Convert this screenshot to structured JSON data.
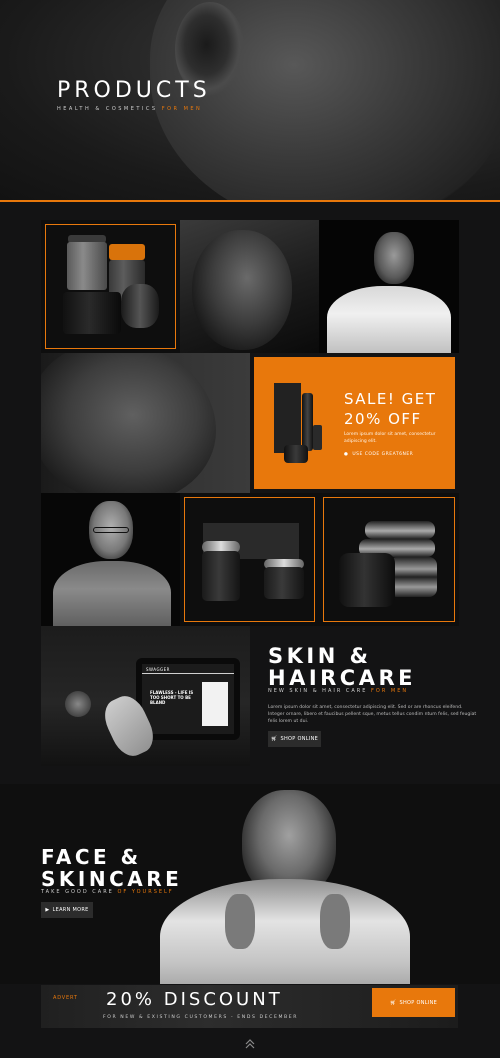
{
  "hero": {
    "title": "PRODUCTS",
    "subtitle": "HEALTH & COSMETICS",
    "subtitle_accent": "FOR MEN"
  },
  "sale": {
    "title": "SALE! GET 20% OFF",
    "description": "Lorem ipsum dolor sit amet, consectetur adipiscing elit.",
    "code": "USE CODE GREAT6NER"
  },
  "skin": {
    "title_line1": "SKIN &",
    "title_line2": "HAIRCARE",
    "subtitle": "NEW SKIN & HAIR CARE",
    "subtitle_accent": "FOR MEN",
    "description": "Lorem ipsum dolor sit amet, consectetur adipiscing elit. Sed or are rhoncus eleifend. Integer ornare, libero et faucibus pellent sque, metus tellus condim ntum felis, sed feugiat felis lorem ut dui.",
    "button": "SHOP ONLINE"
  },
  "tablet": {
    "brand": "SWAGGER",
    "headline": "FLAWLESS - LIFE IS TOO SHORT TO BE BLAND"
  },
  "face": {
    "title_line1": "FACE &",
    "title_line2": "SKINCARE",
    "subtitle": "TAKE GOOD CARE",
    "subtitle_accent": "OF YOURSELF",
    "button": "LEARN MORE"
  },
  "discount": {
    "advert": "ADVERT",
    "title": "20% DISCOUNT",
    "subtitle": "FOR NEW & EXISTING CUSTOMERS - ENDS DECEMBER",
    "button": "SHOP ONLINE"
  },
  "colors": {
    "accent": "#e8780c",
    "background": "#131314"
  },
  "icons": {
    "sale_bullet": "circle-icon",
    "shop": "cart-icon",
    "learn": "play-icon",
    "scroll": "chevron-up-icon"
  }
}
